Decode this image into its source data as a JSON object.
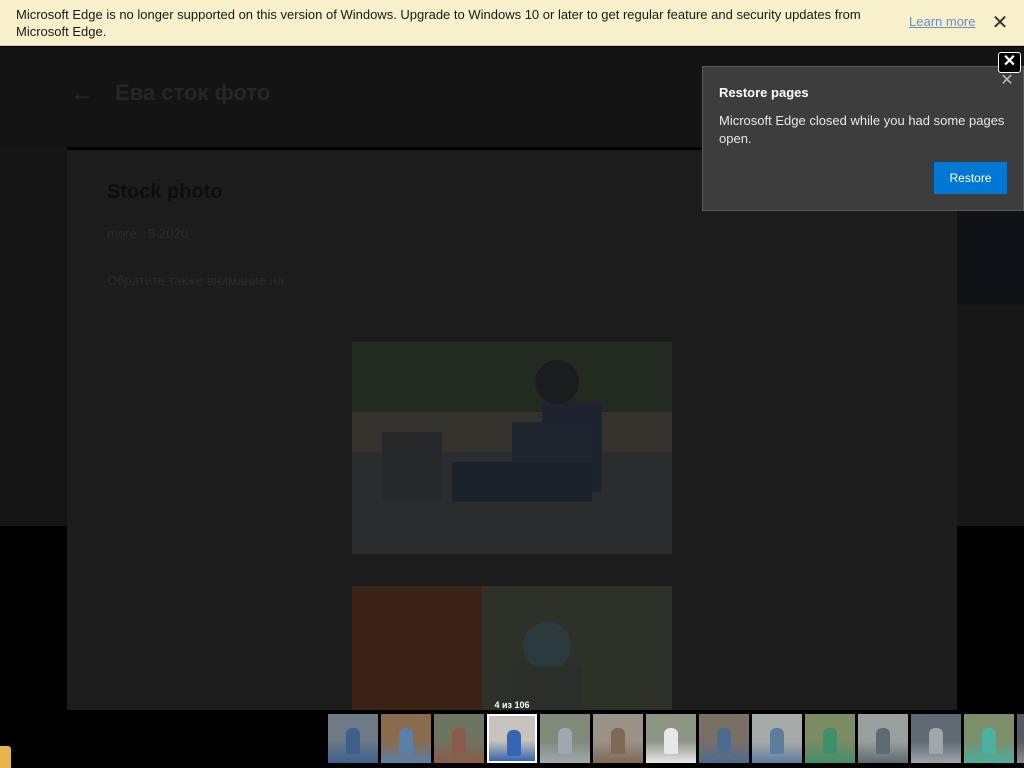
{
  "infobar": {
    "message": "Microsoft Edge is no longer supported on this version of Windows. Upgrade to Windows 10 or later to get regular feature and security updates from Microsoft Edge.",
    "link": "Learn more",
    "close_icon": "close-icon"
  },
  "page": {
    "back_icon": "back-arrow-icon",
    "site_title": "Ева сток фото",
    "card_title": "Stock photo",
    "card_meta": "more · 5 2020",
    "card_note": "Обратите также внимание на"
  },
  "restore_popup": {
    "title": "Restore pages",
    "message": "Microsoft Edge closed while you had some pages open.",
    "button": "Restore",
    "close_icon": "close-icon"
  },
  "lightbox": {
    "close_icon": "close-icon",
    "counter": "4 из 106",
    "thumbnails": [
      {
        "color": "#6e7a86",
        "accent": "#3d5f8c"
      },
      {
        "color": "#8a6b4e",
        "accent": "#5a7fa8"
      },
      {
        "color": "#6d7560",
        "accent": "#8c5a4a"
      },
      {
        "color": "#c9c3bd",
        "accent": "#3566b0"
      },
      {
        "color": "#7f8a7a",
        "accent": "#9fa8b0"
      },
      {
        "color": "#9a9286",
        "accent": "#7e6a55"
      },
      {
        "color": "#8d9584",
        "accent": "#e8e8e8"
      },
      {
        "color": "#7a6f64",
        "accent": "#4d6a8f"
      },
      {
        "color": "#a7aba8",
        "accent": "#5d7d9e"
      },
      {
        "color": "#7b8c62",
        "accent": "#3f8f6b"
      },
      {
        "color": "#9aa09e",
        "accent": "#5e6a70"
      },
      {
        "color": "#5f6a74",
        "accent": "#a0a6aa"
      },
      {
        "color": "#7c8e6a",
        "accent": "#4ab0a0"
      },
      {
        "color": "#545a60",
        "accent": "#8a8f94"
      }
    ]
  }
}
